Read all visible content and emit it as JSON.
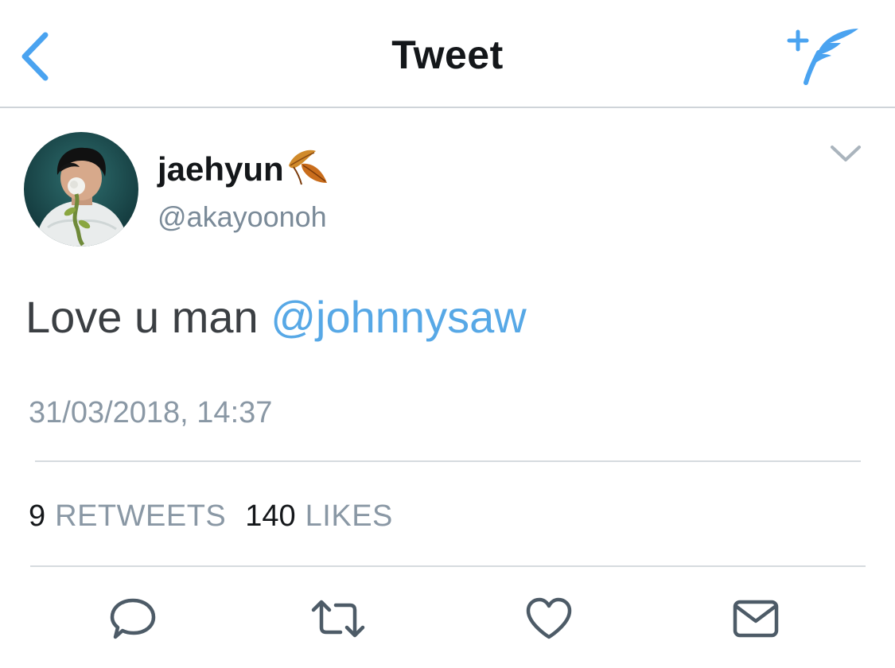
{
  "header": {
    "title": "Tweet",
    "back_icon": "chevron-left-icon",
    "compose_icon": "compose-tweet-icon",
    "accent_color": "#4aa3f0"
  },
  "tweet": {
    "author": {
      "display_name": "jaehyun",
      "name_emoji": "fallen-leaf-emoji",
      "handle": "@akayoonoh"
    },
    "text": "Love u man ",
    "mention": "@johnnysaw",
    "timestamp": "31/03/2018, 14:37",
    "mention_color": "#57a8e6"
  },
  "stats": {
    "retweets_count": "9",
    "retweets_label": "RETWEETS",
    "likes_count": "140",
    "likes_label": "LIKES"
  },
  "actions": [
    {
      "name": "reply",
      "icon": "reply-icon"
    },
    {
      "name": "retweet",
      "icon": "retweet-icon"
    },
    {
      "name": "like",
      "icon": "heart-icon"
    },
    {
      "name": "share",
      "icon": "envelope-icon"
    }
  ]
}
